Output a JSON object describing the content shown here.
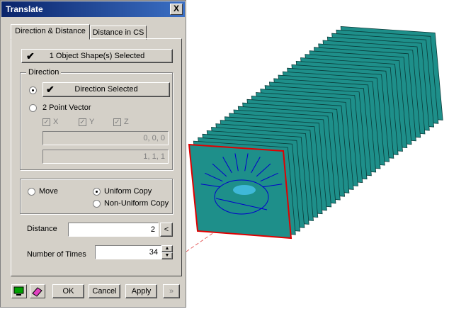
{
  "dialog": {
    "title": "Translate",
    "close_label": "X",
    "tabs": [
      {
        "label": "Direction & Distance"
      },
      {
        "label": "Distance in CS"
      }
    ],
    "selection_button": "1 Object Shape(s) Selected",
    "direction_group": {
      "label": "Direction",
      "direction_selected": "Direction Selected",
      "two_point_vector": "2 Point Vector",
      "x_label": "X",
      "y_label": "Y",
      "z_label": "Z",
      "point1_value": "0, 0, 0",
      "point2_value": "1, 1, 1"
    },
    "mode": {
      "move": "Move",
      "uniform_copy": "Uniform Copy",
      "non_uniform_copy": "Non-Uniform Copy",
      "selected": "uniform_copy"
    },
    "distance": {
      "label": "Distance",
      "value": "2",
      "pick_label": "<"
    },
    "number_of_times": {
      "label": "Number of Times",
      "value": "34"
    },
    "footer": {
      "ok": "OK",
      "cancel": "Cancel",
      "apply": "Apply",
      "more": "»"
    }
  },
  "viewport": {
    "shape_color": "#1e8f8a",
    "selected_edge_color": "#e00000",
    "copy_count_drawn": 34
  }
}
